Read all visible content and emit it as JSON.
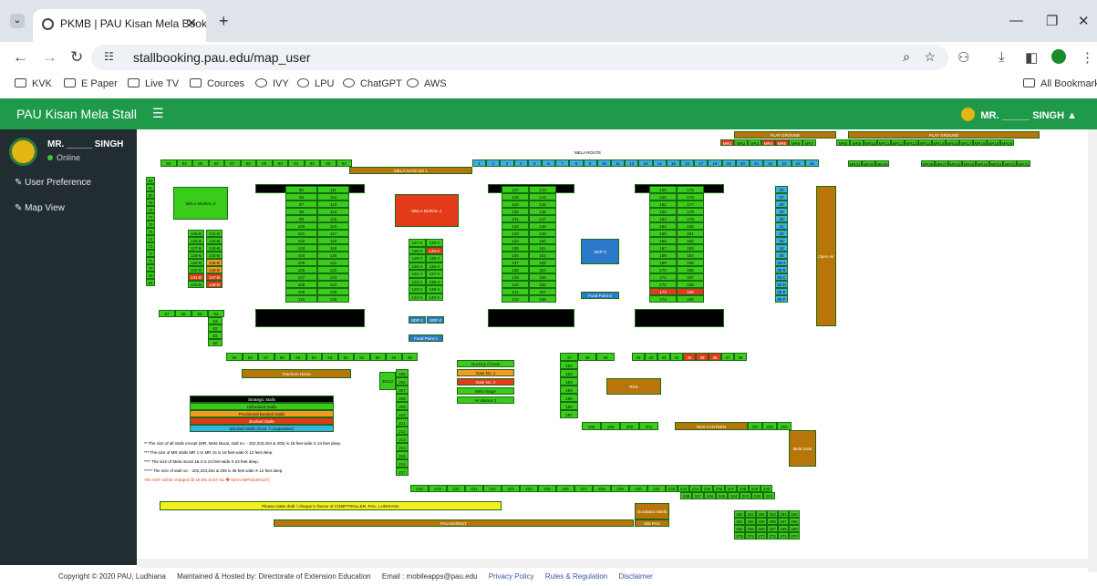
{
  "tab": {
    "title": "PKMB | PAU Kisan Mela Booking P"
  },
  "address": {
    "url": "stallbooking.pau.edu/map_user"
  },
  "bookmarks": [
    "KVK",
    "E Paper",
    "Live TV",
    "Cources",
    "IVY",
    "LPU",
    "ChatGPT",
    "AWS"
  ],
  "all_bookmarks": "All Bookmarks",
  "header": {
    "brand": "PAU Kisan Mela Stall",
    "user": "MR. _____ SINGH"
  },
  "sidebar": {
    "user": "MR. _____ SINGH",
    "status": "Online",
    "items": [
      {
        "label": "User Preference"
      },
      {
        "label": "Map View"
      }
    ]
  },
  "map": {
    "play_ground": "PLAY GROUND",
    "mela_route": "MELA ROUTE",
    "gate1": "MELA GATE NO 1",
    "mural2": "MELA MURAL-2\n(24x24 feet)",
    "mural1": "MELA MURAL-1\n(24x24 feet)",
    "sdp3": "SDP-3",
    "sdp1": "SDP-1",
    "sdp2": "SDP-2",
    "food1": "Food Point-1",
    "food2": "Food Point-2",
    "theatre": "Open Air Theater",
    "teachers_home": "Teachers Home",
    "nursery": "Nursery Chowk",
    "gate_no1": "Gate No. 1",
    "gate_no2": "Gate No. 2",
    "mela_stage": "Mela Stage",
    "air_baloon": "Air Baloon 1",
    "rks": "RKS",
    "rks_canteen": "RKS CANTEEN",
    "mela_gate2": "Mela Gate No. 2",
    "gurdwara": "Gurdwara Sahib",
    "sbi": "SBI PAU",
    "draft_note": "Please make draft / cheque in favour of COMPTROLLER, PAU, LUDHIANA",
    "pau_market": "PAU MARKET",
    "legend": {
      "title": "Strategic Stalls",
      "items": [
        "Unbooked Stalls",
        "Provisional Booked Stalls",
        "Booked Stalls",
        "Blocked Stalls (Govt. / cooperative)"
      ]
    },
    "notes": [
      "** The size of all stalls except (MR, Mela Mural, stall no: - 202,203,204 & 205) is 18 feet wide X 24 feet deep.",
      "*** The size of MR stalls MR 1 to MR 15 is 18 feet wide X 12 feet deep.",
      "**** The size of Mela mural 1& 2 is 24 feet wide X 24 feet deep.",
      "***** The size of stall no: - 202,203,204 & 205 is 36 feet wide X 12 feet deep.",
      "The GST will be charged @ 18.0% (GST No � 03AAABP0216H127)"
    ],
    "mr_top": [
      "MR1",
      "MR2",
      "MR3",
      "MR4",
      "MR5",
      "MR6",
      "MR7",
      "MR8",
      "MR9",
      "MR10",
      "MR11",
      "MR12",
      "MR13",
      "MR14",
      "MR15",
      "MR16",
      "MR17",
      "MR18",
      "MR19",
      "MR20"
    ],
    "mr_second": [
      "MR31",
      "MR30",
      "MR29",
      "MR28",
      "MR27",
      "MR26",
      "MR25",
      "MR24",
      "MR23",
      "MR22",
      "MR21"
    ],
    "row83_94": [
      "83",
      "84",
      "85",
      "86",
      "87",
      "88",
      "89",
      "90",
      "91",
      "92",
      "93",
      "94"
    ],
    "row1_25": [
      "1",
      "2",
      "3",
      "4",
      "5",
      "6",
      "7",
      "8",
      "9",
      "10",
      "11",
      "12",
      "13",
      "14",
      "15",
      "16",
      "17",
      "18",
      "19",
      "20",
      "21",
      "22",
      "23",
      "24",
      "25"
    ],
    "col82_68": [
      "82",
      "81",
      "80",
      "79",
      "78",
      "77",
      "76",
      "75",
      "74",
      "73",
      "72",
      "71",
      "70",
      "69",
      "68"
    ],
    "row67_64": [
      "67",
      "66",
      "65",
      "64"
    ],
    "col63_60": [
      "63",
      "62",
      "61",
      "60"
    ],
    "row59_48": [
      "59",
      "58",
      "57",
      "56",
      "55",
      "54",
      "53",
      "52",
      "51",
      "50",
      "49",
      "48"
    ],
    "col125B": [
      "125-B",
      "126-B",
      "127-B",
      "128-B",
      "129-B",
      "130-B",
      "131-B",
      "132-B"
    ],
    "col141B": [
      "141-B",
      "142-B",
      "143-B",
      "144-B",
      "145-B",
      "146-B",
      "147-B",
      "148-B"
    ],
    "col95": [
      "95",
      "96",
      "97",
      "98",
      "99",
      "100",
      "101",
      "102",
      "103",
      "104",
      "105",
      "106",
      "107",
      "108",
      "109",
      "110"
    ],
    "col111": [
      "111",
      "112",
      "113",
      "114",
      "115",
      "116",
      "117",
      "118",
      "119",
      "120",
      "121",
      "122",
      "123",
      "124",
      "125",
      "126"
    ],
    "col117A": [
      "117-A",
      "118-A",
      "119-A",
      "120-A",
      "121-A",
      "122-A",
      "123-A",
      "124-A"
    ],
    "col133A": [
      "133-A",
      "134-A",
      "135-A",
      "136-A",
      "137-A",
      "138-A",
      "139-A",
      "140-A"
    ],
    "col127": [
      "127",
      "128",
      "129",
      "130",
      "131",
      "132",
      "133",
      "134",
      "135",
      "136",
      "137",
      "138",
      "139",
      "140",
      "141",
      "142"
    ],
    "col143": [
      "143",
      "144",
      "145",
      "146",
      "147",
      "148",
      "149",
      "150",
      "151",
      "152",
      "153",
      "154",
      "155",
      "156",
      "157",
      "158"
    ],
    "col159": [
      "159",
      "160",
      "161",
      "162",
      "163",
      "164",
      "165",
      "166",
      "167",
      "168",
      "169",
      "170",
      "171",
      "172",
      "173",
      "174"
    ],
    "col175": [
      "175",
      "176",
      "177",
      "178",
      "179",
      "180",
      "181",
      "182",
      "183",
      "184",
      "185",
      "186",
      "187",
      "188",
      "189",
      "190"
    ],
    "col26": [
      "26",
      "27",
      "28",
      "29",
      "30",
      "31",
      "32",
      "33",
      "34",
      "35",
      "35-A",
      "35-B",
      "35-C",
      "35-D",
      "35-E",
      "35-F"
    ],
    "row47": [
      "47",
      "46",
      "45"
    ],
    "row44_36": [
      "44",
      "43",
      "42",
      "41",
      "40",
      "39",
      "38",
      "37",
      "36"
    ],
    "col191": [
      "191",
      "192",
      "193",
      "194",
      "195",
      "196",
      "197"
    ],
    "row198": [
      "198",
      "199",
      "200",
      "201"
    ],
    "row202": [
      "202",
      "203",
      "204"
    ],
    "col205": [
      "205",
      "206",
      "207",
      "208",
      "209",
      "210",
      "211",
      "212",
      "213",
      "214",
      "215",
      "216",
      "217"
    ],
    "s36x12": "36x12",
    "row218": [
      "218",
      "219",
      "220",
      "221",
      "222",
      "223",
      "224",
      "225",
      "226",
      "227",
      "228",
      "229",
      "230",
      "231",
      "232",
      "233",
      "234",
      "235",
      "236",
      "237",
      "238",
      "239",
      "240"
    ],
    "row248": [
      "248",
      "247",
      "246",
      "245",
      "244",
      "243",
      "242",
      "241"
    ],
    "g249": [
      "250",
      "251",
      "252",
      "253",
      "254",
      "255",
      "261",
      "260",
      "259",
      "258",
      "257",
      "256",
      "264",
      "265",
      "266",
      "267",
      "268",
      "269",
      "275",
      "274",
      "273",
      "272",
      "271",
      "270"
    ]
  },
  "footer": {
    "copyright": "Copyright © 2020 PAU, Ludhiana",
    "maintained": "Maintained & Hosted by: Directorate of Extension Education",
    "email": "Email : mobileapps@pau.edu",
    "links": [
      "Privacy Policy",
      "Rules & Regulation",
      "Disclaimer"
    ]
  }
}
